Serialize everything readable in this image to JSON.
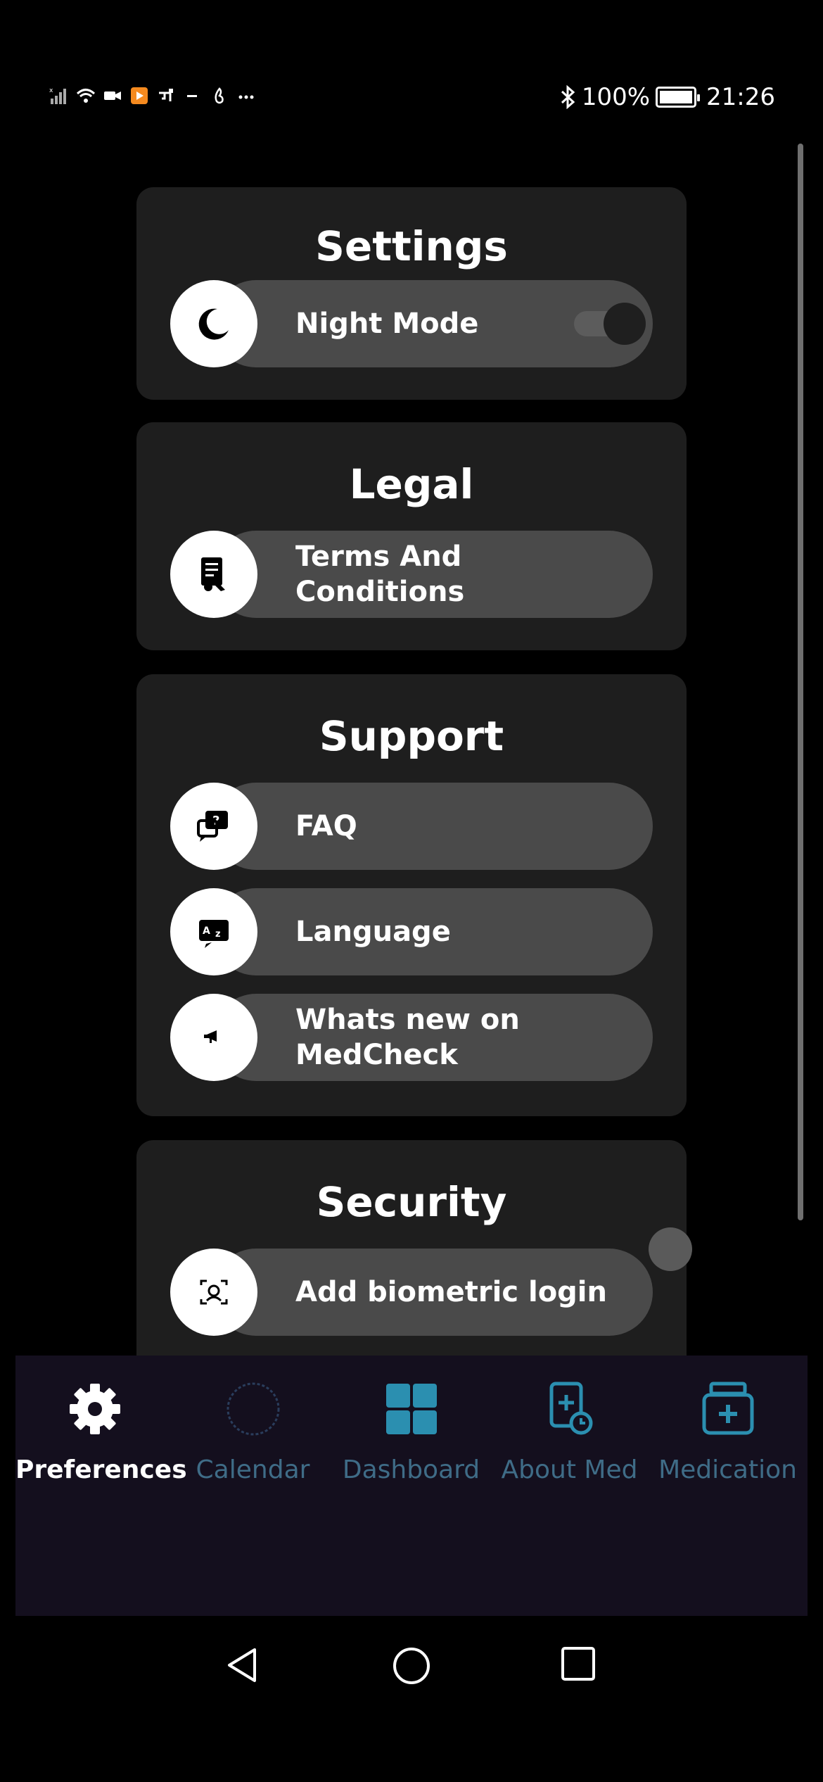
{
  "status_bar": {
    "battery": "100%",
    "time": "21:26",
    "left_icons": [
      "signal-icon",
      "wifi-icon",
      "video-icon",
      "media-icon",
      "usb-icon",
      "minus-icon",
      "flame-icon",
      "more-icon"
    ],
    "bluetooth_icon": "bluetooth-icon"
  },
  "sections": {
    "settings": {
      "title": "Settings",
      "night_mode": {
        "label": "Night Mode",
        "icon": "moon-icon",
        "enabled": true
      }
    },
    "legal": {
      "title": "Legal",
      "terms": {
        "label": "Terms And Conditions",
        "icon": "document-icon"
      }
    },
    "support": {
      "title": "Support",
      "faq": {
        "label": "FAQ",
        "icon": "faq-chat-icon"
      },
      "language": {
        "label": "Language",
        "icon": "translate-icon"
      },
      "whats_new": {
        "label": "Whats new on MedCheck",
        "icon": "announcement-icon"
      }
    },
    "security": {
      "title": "Security",
      "biometric": {
        "label": "Add biometric login",
        "icon": "face-scan-icon"
      }
    }
  },
  "bottom_nav": {
    "items": [
      {
        "label": "Preferences",
        "icon": "gear-icon",
        "active": true
      },
      {
        "label": "Calendar",
        "icon": "calendar-circle-icon",
        "active": false
      },
      {
        "label": "Dashboard",
        "icon": "dashboard-grid-icon",
        "active": false
      },
      {
        "label": "About Med",
        "icon": "med-info-icon",
        "active": false
      },
      {
        "label": "Medication",
        "icon": "medicine-box-icon",
        "active": false
      }
    ],
    "colors": {
      "active": "#ffffff",
      "inactive": "#3f6c87",
      "background": "#140f1e"
    }
  },
  "system_nav": {
    "back": "back-triangle-icon",
    "home": "home-circle-icon",
    "recents": "recents-square-icon"
  },
  "colors": {
    "card_bg": "#1e1e1e",
    "pill_bg": "#4a4a4a",
    "accent": "#2b8fb0"
  }
}
